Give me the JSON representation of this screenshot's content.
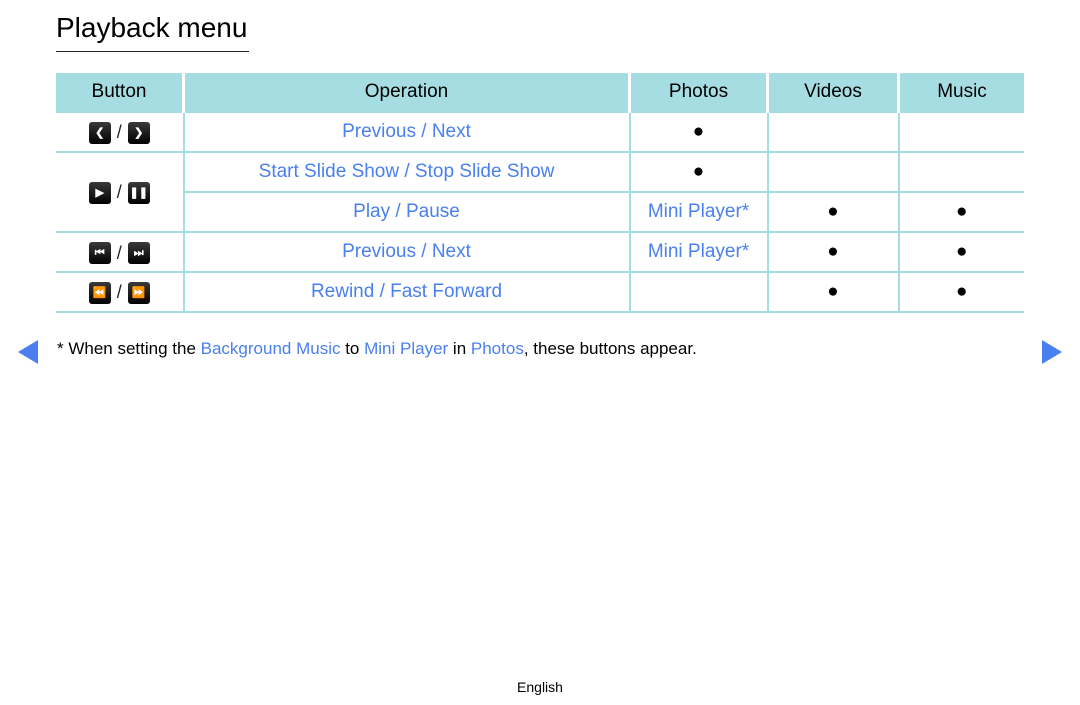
{
  "page": {
    "title": "Playback menu",
    "language": "English"
  },
  "table": {
    "headers": [
      "Button",
      "Operation",
      "Photos",
      "Videos",
      "Music"
    ],
    "bullet": "●",
    "slash": "/",
    "rows": [
      {
        "buttons": [
          "chevron-left",
          "chevron-right"
        ],
        "operation": "Previous / Next",
        "photos": "●",
        "videos": "",
        "music": ""
      },
      {
        "buttons": [
          "play",
          "pause"
        ],
        "operation": "Start Slide Show / Stop Slide Show",
        "photos": "●",
        "videos": "",
        "music": ""
      },
      {
        "buttons": [
          "play",
          "pause"
        ],
        "operation": "Play / Pause",
        "photos": "Mini Player*",
        "videos": "●",
        "music": "●"
      },
      {
        "buttons": [
          "skip-back",
          "skip-forward"
        ],
        "operation": "Previous / Next",
        "photos": "Mini Player*",
        "videos": "●",
        "music": "●"
      },
      {
        "buttons": [
          "rewind",
          "fast-forward"
        ],
        "operation": "Rewind / Fast Forward",
        "photos": "",
        "videos": "●",
        "music": "●"
      }
    ]
  },
  "note": {
    "prefix": "* When setting the ",
    "term1": "Background Music",
    "mid1": " to ",
    "term2": "Mini Player",
    "mid2": " in ",
    "term3": "Photos",
    "suffix": ", these buttons appear."
  },
  "nav": {
    "prev_icon": "triangle-left",
    "next_icon": "triangle-right"
  },
  "colors": {
    "accent": "#4a7ff0",
    "header_bg": "#a6dde2"
  }
}
